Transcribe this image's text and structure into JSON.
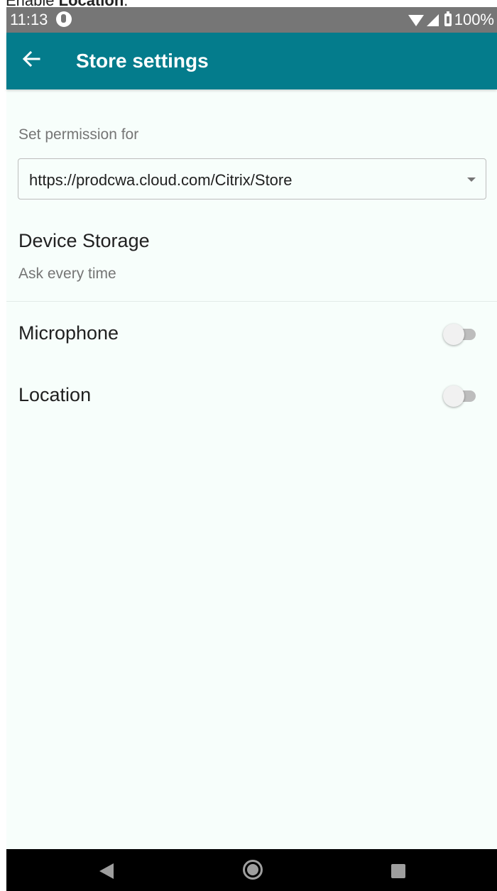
{
  "caption": {
    "prefix": "Enable ",
    "emphasis": "Location",
    "suffix": "."
  },
  "status_bar": {
    "time": "11:13",
    "battery": "100%",
    "icons": [
      "notification-icon",
      "wifi-icon",
      "cell-signal-icon",
      "battery-icon"
    ]
  },
  "app_bar": {
    "title": "Store settings",
    "back_icon": "arrow-back-icon",
    "color": "#047c8c"
  },
  "permission": {
    "label": "Set permission for",
    "selected_store": "https://prodcwa.cloud.com/Citrix/Store"
  },
  "device_storage": {
    "title": "Device Storage",
    "value": "Ask every time"
  },
  "toggles": [
    {
      "label": "Microphone",
      "enabled": false
    },
    {
      "label": "Location",
      "enabled": false
    }
  ],
  "nav_bar": {
    "icons": [
      "nav-back-icon",
      "nav-home-icon",
      "nav-recents-icon"
    ]
  }
}
